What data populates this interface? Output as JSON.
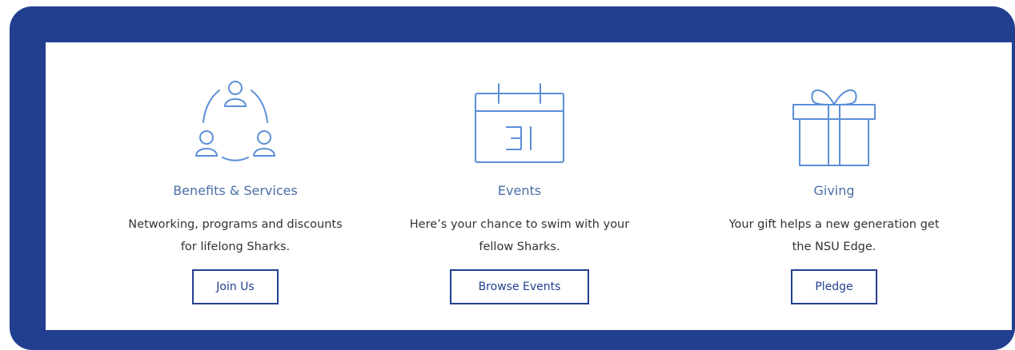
{
  "colors": {
    "frame": "#223f8f",
    "accent": "#223f8f",
    "icon": "#5b8fd6",
    "title": "#4a6fa5"
  },
  "cards": [
    {
      "icon": "people-network-icon",
      "title": "Benefits & Services",
      "description_line1": "Networking, programs and discounts",
      "description_line2": "for lifelong Sharks.",
      "button": "Join Us"
    },
    {
      "icon": "calendar-icon",
      "title": "Events",
      "description_line1": "Here’s your chance to swim with your",
      "description_line2": "fellow Sharks.",
      "button": "Browse Events"
    },
    {
      "icon": "gift-icon",
      "title": "Giving",
      "description_line1": "Your gift helps a new generation get",
      "description_line2": "the NSU Edge.",
      "button": "Pledge"
    }
  ]
}
